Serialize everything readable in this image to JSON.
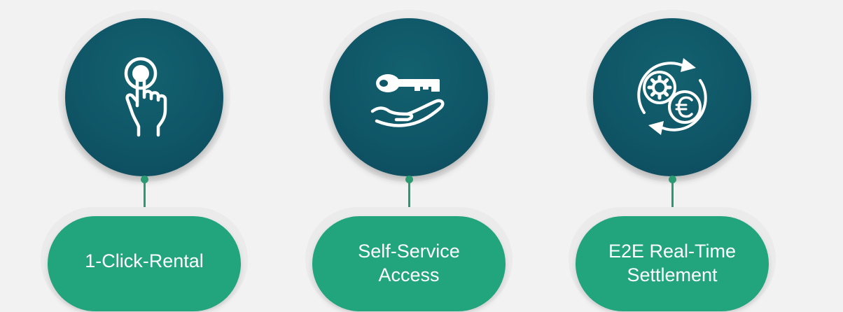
{
  "features": [
    {
      "label": "1-Click-Rental",
      "icon": "finger-tap-icon"
    },
    {
      "label": "Self-Service\nAccess",
      "icon": "key-hand-icon"
    },
    {
      "label": "E2E Real-Time\nSettlement",
      "icon": "gear-euro-cycle-icon"
    }
  ],
  "colors": {
    "circle": "#0f5667",
    "pill": "#22a57d",
    "connector": "#2a9a72",
    "background": "#f2f2f2"
  }
}
